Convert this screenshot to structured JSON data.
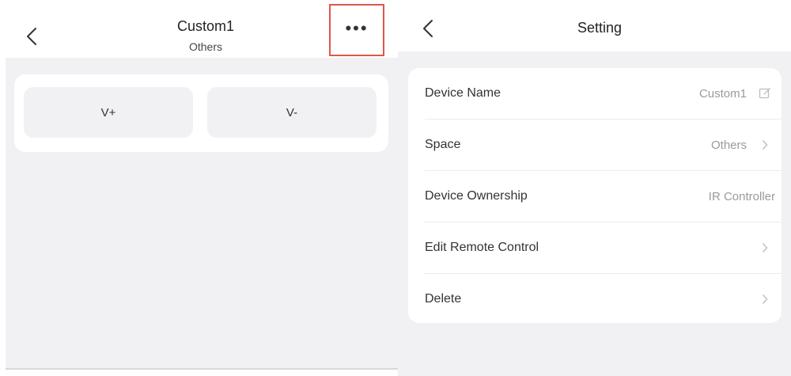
{
  "remote": {
    "title": "Custom1",
    "subtitle": "Others",
    "keys": [
      "V+",
      "V-"
    ]
  },
  "settings": {
    "title": "Setting",
    "rows": [
      {
        "label": "Device Name",
        "value": "Custom1",
        "icon": "edit-icon"
      },
      {
        "label": "Space",
        "value": "Others",
        "icon": "chevron-right-icon"
      },
      {
        "label": "Device Ownership",
        "value": "IR Controller",
        "icon": ""
      },
      {
        "label": "Edit Remote Control",
        "value": "",
        "icon": "chevron-right-icon"
      },
      {
        "label": "Delete",
        "value": "",
        "icon": "chevron-right-icon"
      }
    ]
  },
  "icons": {
    "back": "chevron-left-icon",
    "more": "more-horizontal-icon"
  },
  "colors": {
    "highlight": "#e0554a",
    "page_background": "#f1f1f3",
    "card_background": "#ffffff",
    "secondary_text": "#9a9a9a"
  }
}
